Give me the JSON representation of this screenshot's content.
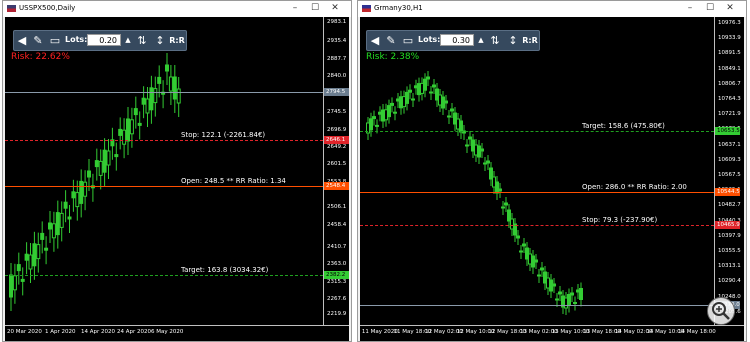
{
  "windows": [
    {
      "id": "w1",
      "title": "USSPX500,Daily",
      "flag": "us-flag",
      "toolbar": {
        "lots_label": "Lots:",
        "lots_value": "0.20",
        "rr_label": "R:R"
      },
      "risk": {
        "text": "Risk: 22.62%",
        "color": "#ff2020"
      },
      "y_ticks": [
        "2983.1",
        "2935.4",
        "2887.7",
        "2840.0",
        "2745.5",
        "2696.9",
        "2649.2",
        "2601.5",
        "2553.8",
        "2506.1",
        "2458.4",
        "2410.7",
        "2363.0",
        "2315.3",
        "2267.6",
        "2219.9"
      ],
      "y_tags": [
        {
          "text": "2794.5",
          "bg": "#6b7d8f",
          "fg": "#ffffff"
        },
        {
          "text": "2646.1",
          "bg": "#e0242a",
          "fg": "#ffffff"
        },
        {
          "text": "2548.4",
          "bg": "#ff4f00",
          "fg": "#ffffff"
        },
        {
          "text": "2382.2",
          "bg": "#33cc33",
          "fg": "#000000"
        }
      ],
      "x_ticks": [
        "20 Mar 2020",
        "1 Apr 2020",
        "14 Apr 2020",
        "24 Apr 2020",
        "6 May 2020"
      ],
      "levels": {
        "stop": {
          "label": "Stop: 122.1 (-2261.84€)",
          "color": "#e0242a"
        },
        "open": {
          "label": "Open: 248.5 ** RR Ratio: 1.34",
          "color": "#ff4f00"
        },
        "target": {
          "label": "Target: 163.8 (3034.32€)",
          "color": "#1fa01f"
        },
        "current": {
          "color": "#8a9aaa"
        }
      }
    },
    {
      "id": "w2",
      "title": "Grmany30,H1",
      "flag": "de-flag",
      "toolbar": {
        "lots_label": "Lots:",
        "lots_value": "0.30",
        "rr_label": "R:R"
      },
      "risk": {
        "text": "Risk: 2.38%",
        "color": "#22dd22"
      },
      "y_ticks": [
        "10976.3",
        "10933.9",
        "10891.5",
        "10849.1",
        "10806.7",
        "10764.3",
        "10721.9",
        "10679.5",
        "10637.1",
        "10609.3",
        "10567.5",
        "10525.1",
        "10482.7",
        "10440.3",
        "10397.9",
        "10355.5",
        "10313.1",
        "10290.4",
        "10248.0",
        "10205.6"
      ],
      "y_tags": [
        {
          "text": "10653.5",
          "bg": "#33cc33",
          "fg": "#000000"
        },
        {
          "text": "10544.5",
          "bg": "#ff4f00",
          "fg": "#ffffff"
        },
        {
          "text": "10465.9",
          "bg": "#e0242a",
          "fg": "#ffffff"
        },
        {
          "text": "10270.0",
          "bg": "#6b7d8f",
          "fg": "#ffffff"
        }
      ],
      "x_ticks": [
        "11 May 2020",
        "11 May 18:00",
        "12 May 02:00",
        "12 May 10:00",
        "12 May 18:00",
        "13 May 02:00",
        "13 May 10:00",
        "13 May 18:00",
        "14 May 02:00",
        "14 May 10:00",
        "14 May 18:00"
      ],
      "levels": {
        "target": {
          "label": "Target: 158.6 (475.80€)",
          "color": "#1fa01f"
        },
        "open": {
          "label": "Open: 286.0 ** RR Ratio: 2.00",
          "color": "#ff4f00"
        },
        "stop": {
          "label": "Stop: 79.3 (-237.90€)",
          "color": "#e0242a"
        },
        "current": {
          "color": "#8a9aaa"
        }
      }
    }
  ],
  "colors": {
    "candle": "#33cc33",
    "grid_bg": "#000000",
    "win_frame": "#f0f0f0"
  },
  "icons": [
    "us-flag",
    "de-flag",
    "minimize-icon",
    "maximize-icon",
    "close-icon",
    "collapse-left-icon",
    "pencil-icon",
    "eraser-icon",
    "stepper-icon",
    "swap-arrows-icon",
    "vertical-range-icon",
    "zoom-in-icon"
  ]
}
